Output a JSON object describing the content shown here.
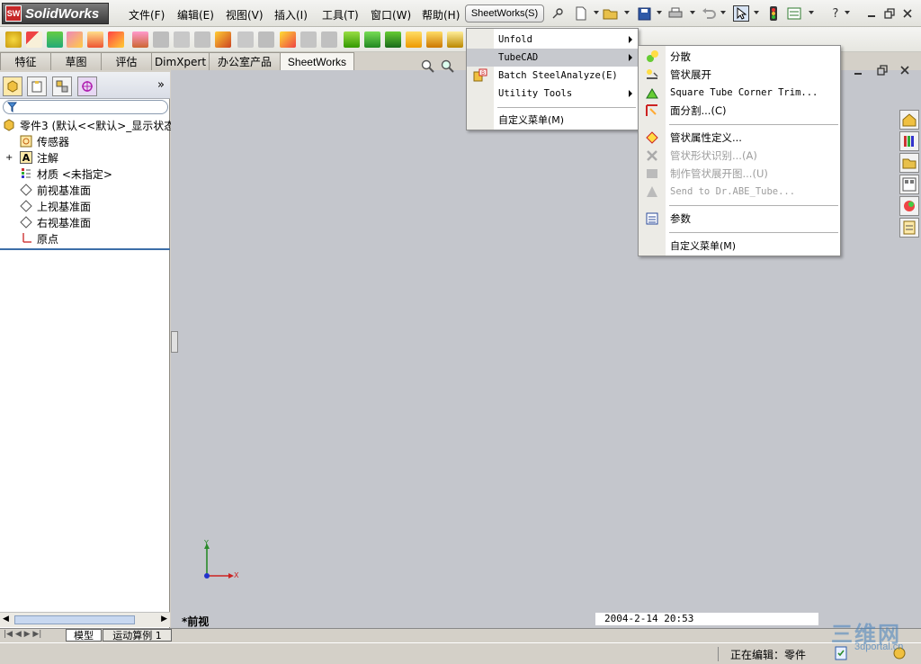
{
  "app": {
    "name": "SolidWorks",
    "badge": "SW"
  },
  "menus": [
    "文件(F)",
    "编辑(E)",
    "视图(V)",
    "插入(I)",
    "工具(T)",
    "窗口(W)",
    "帮助(H)"
  ],
  "sheetworks_button": "SheetWorks(S)",
  "command_tabs": [
    "特征",
    "草图",
    "评估",
    "DimXpert",
    "办公室产品",
    "SheetWorks"
  ],
  "active_tab": "SheetWorks",
  "feature_tree": {
    "root": "零件3  (默认<<默认>_显示状态",
    "items": [
      "传感器",
      "注解",
      "材质 <未指定>",
      "前视基准面",
      "上视基准面",
      "右视基准面",
      "原点"
    ],
    "collapse_label": "»"
  },
  "sheetworks_menu": [
    {
      "label": "Unfold",
      "submenu": true
    },
    {
      "label": "TubeCAD",
      "submenu": true,
      "highlighted": true
    },
    {
      "label": "Batch SteelAnalyze(E)",
      "submenu": false
    },
    {
      "label": "Utility Tools",
      "submenu": true
    },
    {
      "label": "自定义菜单(M)",
      "submenu": false
    }
  ],
  "tubecad_menu": [
    {
      "label": "分散",
      "disabled": false
    },
    {
      "label": "管状展开",
      "disabled": false
    },
    {
      "label": "Square Tube Corner Trim...",
      "disabled": false
    },
    {
      "label": "面分割...(C)",
      "disabled": false
    },
    {
      "label": "管状属性定义...",
      "disabled": false
    },
    {
      "label": "管状形状识别...(A)",
      "disabled": true
    },
    {
      "label": "制作管状展开图...(U)",
      "disabled": true
    },
    {
      "label": "Send to Dr.ABE_Tube...",
      "disabled": true
    },
    {
      "label": "参数",
      "disabled": false
    },
    {
      "label": "自定义菜单(M)",
      "disabled": false
    }
  ],
  "viewport": {
    "view_label": "*前视",
    "timestamp": "2004-2-14 20:53",
    "axis_x": "X",
    "axis_y": "Y"
  },
  "bottom_tabs": [
    "模型",
    "运动算例 1"
  ],
  "status": {
    "editing": "正在编辑：零件"
  },
  "watermark": {
    "text": "三维网",
    "sub": "3dportal.cn"
  },
  "colors": {
    "accent": "#3c6ea8",
    "logo_red": "#c62828"
  }
}
